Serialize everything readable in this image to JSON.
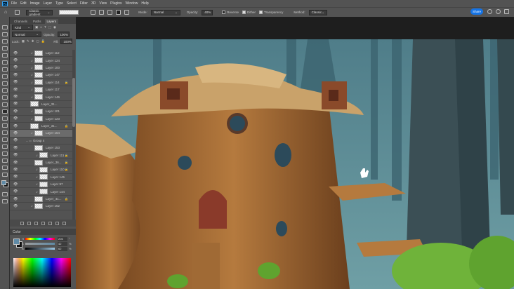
{
  "app": {
    "logo": "Ps"
  },
  "menu": [
    "File",
    "Edit",
    "Image",
    "Layer",
    "Type",
    "Select",
    "Filter",
    "3D",
    "View",
    "Plugins",
    "Window",
    "Help"
  ],
  "options": {
    "preset": "Classic gradient",
    "mode_label": "Mode:",
    "mode": "Normal",
    "opacity_label": "Opacity:",
    "opacity": "40%",
    "reverse": "Reverse",
    "reverse_checked": false,
    "dither": "Dither",
    "dither_checked": true,
    "transparency": "Transparency",
    "transparency_checked": true,
    "method_label": "Method:",
    "method": "Classic",
    "share": "Share"
  },
  "panel": {
    "tabs": [
      "Channels",
      "Paths",
      "Layers"
    ],
    "active_tab": "Layers",
    "filter": "Kind",
    "blend": "Normal",
    "opacity_label": "Opacity:",
    "opacity": "100%",
    "lock_label": "Lock:",
    "fill_label": "Fill:",
    "fill": "100%"
  },
  "layers": [
    {
      "name": "Layer 112",
      "clip": true
    },
    {
      "name": "Layer 124",
      "clip": true
    },
    {
      "name": "Layer 100",
      "clip": true
    },
    {
      "name": "Layer 147",
      "clip": true
    },
    {
      "name": "Layer 114",
      "clip": true,
      "locked": true
    },
    {
      "name": "Layer 117",
      "clip": true
    },
    {
      "name": "Layer 146",
      "clip": true
    },
    {
      "name": "Layer_31..."
    },
    {
      "name": "Layer 101",
      "clip": true
    },
    {
      "name": "Layer 123",
      "clip": true
    },
    {
      "name": "Layer_31...",
      "locked": true
    },
    {
      "name": "Layer 154",
      "clip": true,
      "selected": true
    },
    {
      "name": "Group 4",
      "group": true
    },
    {
      "name": "Layer 153",
      "indent": true
    },
    {
      "name": "Layer 111",
      "clip": true,
      "indent": true,
      "locked": true
    },
    {
      "name": "Layer_36...",
      "indent": true,
      "locked": true
    },
    {
      "name": "Layer 110",
      "clip": true,
      "indent": true,
      "locked": true
    },
    {
      "name": "Layer 145",
      "clip": true,
      "indent": true
    },
    {
      "name": "Layer 97",
      "clip": true,
      "indent": true
    },
    {
      "name": "Layer 144",
      "clip": true,
      "indent": true
    },
    {
      "name": "Layer_41...",
      "indent": true,
      "locked": true
    },
    {
      "name": "Layer 152",
      "clip": true
    }
  ],
  "color": {
    "title": "Color",
    "h_label": "H",
    "h": "206",
    "s_label": "S",
    "s": "42",
    "b_label": "B",
    "b": "62",
    "deg": "°",
    "pct": "%",
    "foreground": "#5f8aa6",
    "background": "#111111"
  }
}
